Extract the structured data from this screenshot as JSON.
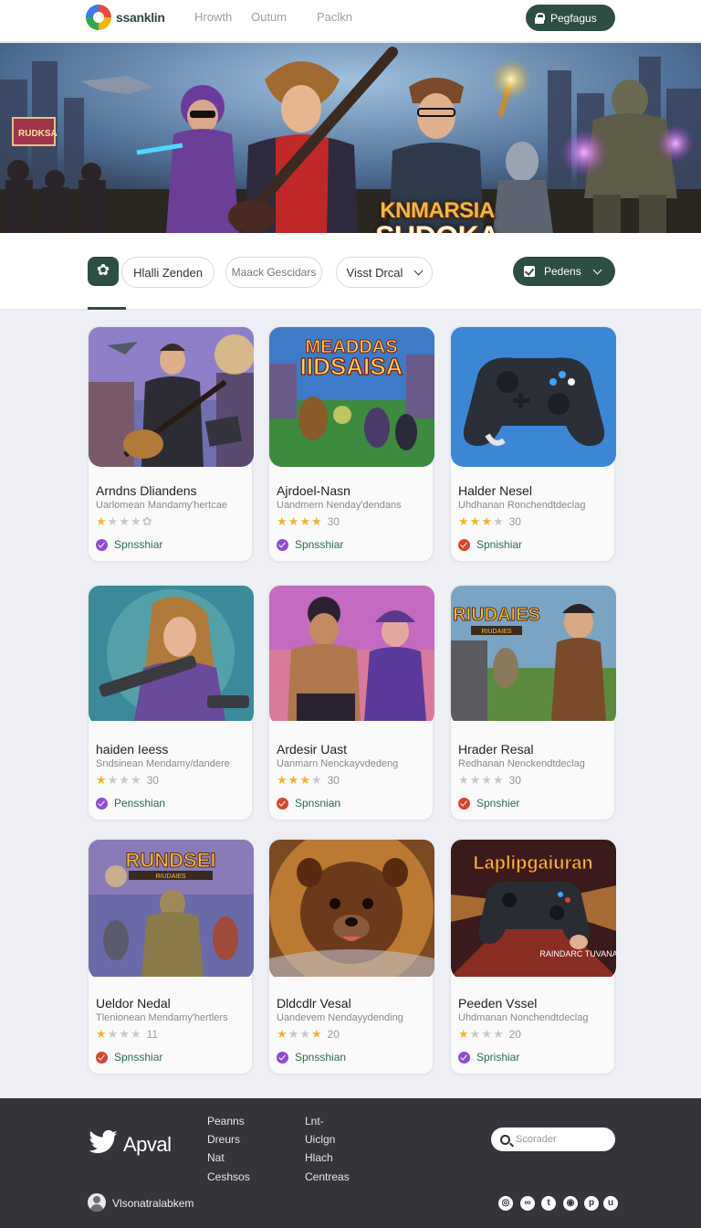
{
  "nav": {
    "brand": "ssanklin",
    "links": [
      "Hrowth",
      "Outum",
      "Paclkn"
    ],
    "cta": "Pegfagus"
  },
  "hero": {
    "title_line1": "KNMARSIA",
    "title_line2": "SUDOKA"
  },
  "filters": {
    "chip_active": "Hlalli Zenden",
    "chip_two": "Maack Gescidars",
    "dropdown": "Visst Drcal",
    "sort_label": "Pedens"
  },
  "cards": [
    {
      "title": "Arndns Dliandens",
      "sub": "Uarlomean Mandamy'hertcae",
      "stars": 1,
      "rating": "",
      "badge": "Spnsshiar",
      "badge_color": "purple"
    },
    {
      "title": "Ajrdoel-Nasn",
      "sub": "Uandmern Nenday'dendans",
      "stars": 4,
      "rating": "30",
      "badge": "Spnsshiar",
      "badge_color": "purple"
    },
    {
      "title": "Halder Nesel",
      "sub": "Uhdhanan Ronchendtdeclag",
      "stars": 3,
      "rating": "30",
      "badge": "Spnishiar",
      "badge_color": "red"
    },
    {
      "title": "haiden Ieess",
      "sub": "Sndsinean Mendamy/dandere",
      "stars": 1,
      "rating": "30",
      "badge": "Pensshian",
      "badge_color": "purple"
    },
    {
      "title": "Ardesir Uast",
      "sub": "Uanmarn Nenckayvdedeng",
      "stars": 3,
      "rating": "30",
      "badge": "Spnsnian",
      "badge_color": "red"
    },
    {
      "title": "Hrader Resal",
      "sub": "Redhanan Nenckendtdeclag",
      "stars": 0,
      "rating": "30",
      "badge": "Spnshier",
      "badge_color": "red"
    },
    {
      "title": "Ueldor Nedal",
      "sub": "Tlenionean Mendamy'hertlers",
      "stars": 1,
      "rating": "11",
      "badge": "Spnsshiar",
      "badge_color": "red"
    },
    {
      "title": "Dldcdlr Vesal",
      "sub": "Uandevem Nendayydending",
      "stars": 4,
      "rating": "20",
      "badge": "Spnsshian",
      "badge_color": "purple"
    },
    {
      "title": "Peeden Vssel",
      "sub": "Uhdmanan Nonchendtdeclag",
      "stars": 1,
      "rating": "20",
      "badge": "Sprishiar",
      "badge_color": "purple"
    }
  ],
  "thumb_texts": {
    "card1": "MEADDAS IIDSAISA",
    "card4": "RIUDAIES",
    "card4_sub": "RIUDAIES",
    "card6": "RUNDSEI",
    "card6_sub": "RIUDAIES",
    "card8": "Laplipgaiuran",
    "card8_sub": "RAINDARC TUVANA EES"
  },
  "footer": {
    "brand": "Apval",
    "col1": [
      "Peanns",
      "Dreurs",
      "Nat",
      "Ceshsos"
    ],
    "col2": [
      "Lnt-",
      "Uiclgn",
      "Hlach",
      "Centreas"
    ],
    "search_placeholder": "Scorader",
    "user": "Vlsonatralabkem",
    "social_icons": [
      "circle-icon",
      "link-icon",
      "twitter-icon",
      "instagram-icon",
      "pinterest-icon",
      "u-icon"
    ]
  },
  "colors": {
    "accent": "#2c4f42",
    "star": "#f2b52b",
    "badge_purple": "#8e4bd3",
    "badge_red": "#d8452f",
    "footer_bg": "#34343a"
  }
}
